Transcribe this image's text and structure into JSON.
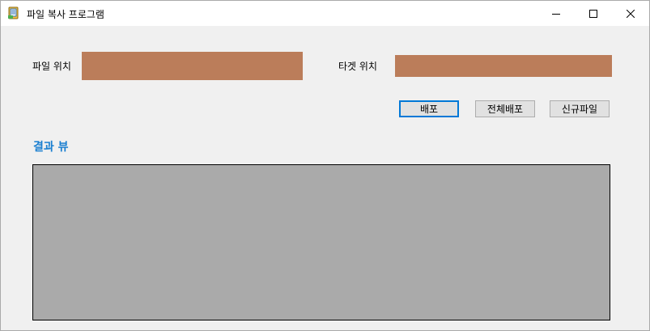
{
  "window": {
    "title": "파일 복사 프로그램",
    "icon": "file-copy-app-icon"
  },
  "caption_buttons": {
    "minimize_icon": "minimize-icon",
    "maximize_icon": "maximize-icon",
    "close_icon": "close-icon"
  },
  "form": {
    "source_label": "파일 위치",
    "source_value": "",
    "target_label": "타겟 위치",
    "target_value": "",
    "field_color": "#bb7d5a"
  },
  "actions": {
    "deploy_label": "배포",
    "deploy_all_label": "전체배포",
    "new_file_label": "신규파일"
  },
  "results": {
    "title": "결과 뷰",
    "title_color": "#1a7fd0",
    "background_color": "#aaaaaa"
  }
}
